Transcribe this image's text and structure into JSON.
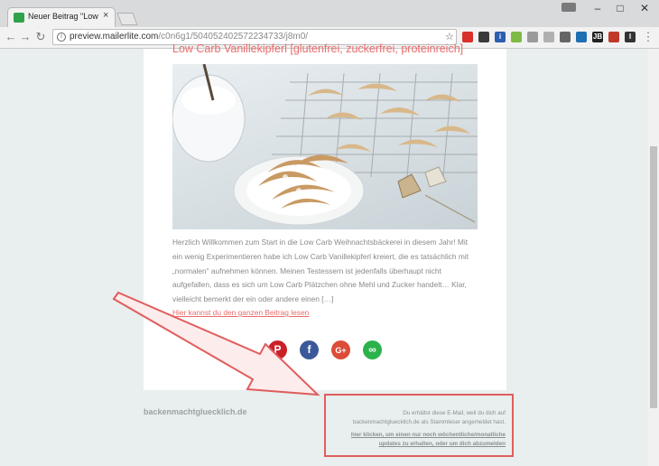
{
  "browser": {
    "tab_title": "Neuer Beitrag \"Low Carb",
    "url_host": "preview.mailerlite.com",
    "url_path": "/c0n6g1/504052402572234733/j8m0/",
    "extensions": [
      {
        "name": "adblock-icon",
        "color": "#d9302c",
        "label": ""
      },
      {
        "name": "crossed-circle-icon",
        "color": "#3a3a3a",
        "label": ""
      },
      {
        "name": "info-icon",
        "color": "#2d5fb0",
        "label": "i"
      },
      {
        "name": "evernote-icon",
        "color": "#7dbb45",
        "label": ""
      },
      {
        "name": "cloud-icon",
        "color": "#9a9a9a",
        "label": ""
      },
      {
        "name": "bolt-icon",
        "color": "#b0b0b0",
        "label": ""
      },
      {
        "name": "pocket-icon",
        "color": "#666666",
        "label": ""
      },
      {
        "name": "trello-icon",
        "color": "#1f6fb2",
        "label": ""
      },
      {
        "name": "jb-icon",
        "color": "#222222",
        "label": "JB"
      },
      {
        "name": "bucket-icon",
        "color": "#c0392b",
        "label": ""
      },
      {
        "name": "dark-icon",
        "color": "#333333",
        "label": "I"
      }
    ]
  },
  "email": {
    "post_title": "Low Carb Vanillekipferl [glutenfrei, zuckerfrei, proteinreich]",
    "excerpt": "Herzlich Willkommen zum Start in die Low Carb Weihnachtsbäckerei in diesem Jahr! Mit ein wenig Experimentieren habe ich Low Carb Vanillekipferl kreiert, die es tatsächlich mit „normalen“ aufnehmen können. Meinen Testessern ist jedenfalls überhaupt nicht aufgefallen, dass es sich um Low Carb Plätzchen ohne Mehl und Zucker handelt… Klar, vielleicht bemerkt der ein oder andere einen […]",
    "read_more": "Hier kannst du den ganzen Beitrag lesen",
    "social": [
      {
        "name": "pinterest-share-button",
        "icon": "pinterest-icon",
        "color": "#cb2027",
        "glyph": "P"
      },
      {
        "name": "facebook-share-button",
        "icon": "facebook-icon",
        "color": "#3b5998",
        "glyph": "f"
      },
      {
        "name": "googleplus-share-button",
        "icon": "google-plus-icon",
        "color": "#dd4b39",
        "glyph": "G+"
      },
      {
        "name": "link-share-button",
        "icon": "link-icon",
        "color": "#2cb24a",
        "glyph": "∞"
      }
    ]
  },
  "footer": {
    "brand": "backenmachtgluecklich.de",
    "notice_line1": "Du erhältst diese E-Mail, weil du dich auf",
    "notice_line2": "backenmachtgluecklich.de als Stammleser angemeldet hast.",
    "unsubscribe_line1": "hier klicken, um einen nur noch wöchentliche/monatliche",
    "unsubscribe_line2": "updates zu erhalten, oder um dich abzumelden"
  },
  "colors": {
    "accent": "#ea6b6b",
    "highlight": "#e05d5d"
  }
}
